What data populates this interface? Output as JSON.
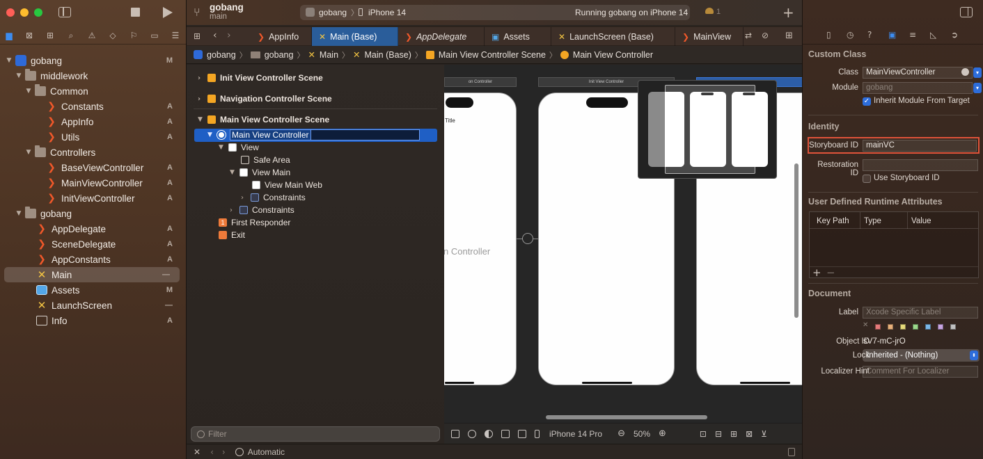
{
  "window": {
    "project_name": "gobang",
    "branch": "main",
    "scheme": "gobang",
    "device": "iPhone 14",
    "run_status": "Running gobang on iPhone 14",
    "warnings_count": "1"
  },
  "navigator": {
    "items": [
      {
        "label": "gobang",
        "badge": "M"
      },
      {
        "label": "middlework",
        "badge": ""
      },
      {
        "label": "Common",
        "badge": ""
      },
      {
        "label": "Constants",
        "badge": "A"
      },
      {
        "label": "AppInfo",
        "badge": "A"
      },
      {
        "label": "Utils",
        "badge": "A"
      },
      {
        "label": "Controllers",
        "badge": ""
      },
      {
        "label": "BaseViewController",
        "badge": "A"
      },
      {
        "label": "MainViewController",
        "badge": "A"
      },
      {
        "label": "InitViewController",
        "badge": "A"
      },
      {
        "label": "gobang",
        "badge": ""
      },
      {
        "label": "AppDelegate",
        "badge": "A"
      },
      {
        "label": "SceneDelegate",
        "badge": "A"
      },
      {
        "label": "AppConstants",
        "badge": "A"
      },
      {
        "label": "Main",
        "badge": "—"
      },
      {
        "label": "Assets",
        "badge": "M"
      },
      {
        "label": "LaunchScreen",
        "badge": "—"
      },
      {
        "label": "Info",
        "badge": "A"
      }
    ]
  },
  "tabs": [
    {
      "label": "AppInfo"
    },
    {
      "label": "Main (Base)"
    },
    {
      "label": "AppDelegate"
    },
    {
      "label": "Assets"
    },
    {
      "label": "LaunchScreen (Base)"
    },
    {
      "label": "MainView"
    }
  ],
  "breadcrumb": [
    "gobang",
    "gobang",
    "Main",
    "Main (Base)",
    "Main View Controller Scene",
    "Main View Controller"
  ],
  "outline": {
    "rows": [
      {
        "label": "Init View Controller Scene"
      },
      {
        "label": "Navigation Controller Scene"
      },
      {
        "label": "Main View Controller Scene"
      },
      {
        "label": "Main View Controller"
      },
      {
        "label": "View"
      },
      {
        "label": "Safe Area"
      },
      {
        "label": "View Main"
      },
      {
        "label": "View Main Web"
      },
      {
        "label": "Constraints"
      },
      {
        "label": "Constraints"
      },
      {
        "label": "First Responder"
      },
      {
        "label": "Exit"
      }
    ],
    "filter_placeholder": "Filter"
  },
  "canvas": {
    "left_scene_label": "on Controller",
    "middle_scene_label": "Init View Controller",
    "title_text": "Title",
    "controller_text": "n Controller",
    "device_config": "iPhone 14 Pro",
    "zoom": "50%"
  },
  "debugbar": {
    "appearance": "Automatic"
  },
  "inspector": {
    "custom_class_header": "Custom Class",
    "class_label": "Class",
    "class_value": "MainViewController",
    "module_label": "Module",
    "module_placeholder": "gobang",
    "inherit_module_label": "Inherit Module From Target",
    "identity_header": "Identity",
    "storyboard_id_label": "Storyboard ID",
    "storyboard_id_value": "mainVC",
    "restoration_id_label": "Restoration ID",
    "use_storyboard_id_label": "Use Storyboard ID",
    "udra_header": "User Defined Runtime Attributes",
    "col_key_path": "Key Path",
    "col_type": "Type",
    "col_value": "Value",
    "document_header": "Document",
    "label_label": "Label",
    "label_placeholder": "Xcode Specific Label",
    "object_id_label": "Object ID",
    "object_id_value": "sV7-mC-jrO",
    "lock_label": "Lock",
    "lock_value": "Inherited - (Nothing)",
    "localizer_label": "Localizer Hint",
    "localizer_placeholder": "Comment For Localizer",
    "highlight_color": "#e0533a",
    "swatches": [
      "#e57a7a",
      "#e8b07a",
      "#e5d97a",
      "#9bd88a",
      "#7ab7e8",
      "#c7a4e0",
      "#c0c0c0"
    ]
  }
}
